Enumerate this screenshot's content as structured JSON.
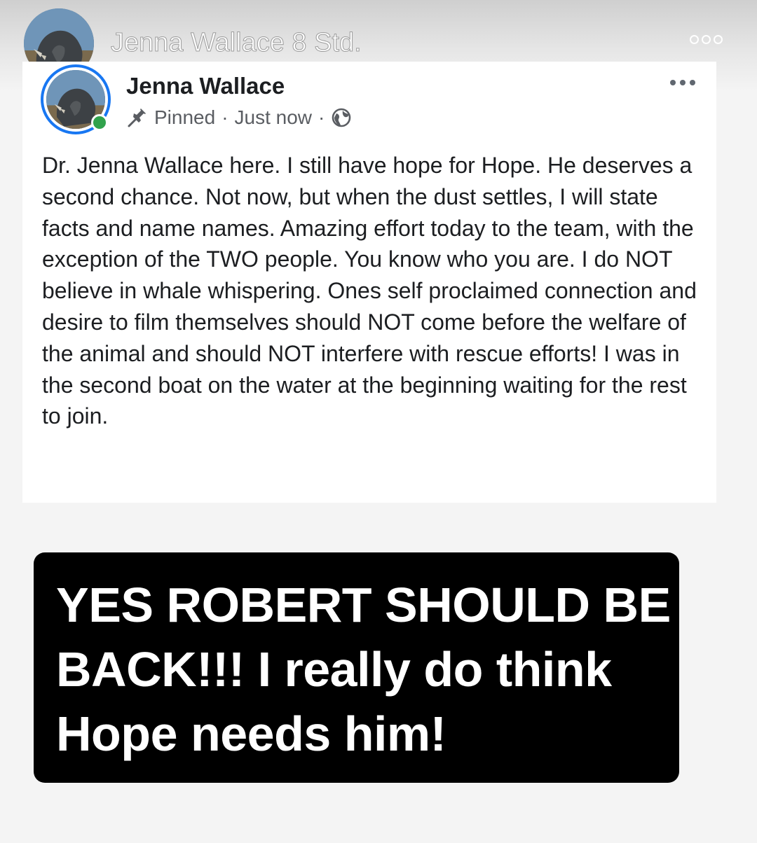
{
  "story": {
    "header_title": "Jenna Wallace 8 Std.",
    "avatar_icon": "profile-avatar-rhino",
    "menu_icon": "more-dots-outline-icon"
  },
  "post": {
    "author_name": "Jenna Wallace",
    "online": true,
    "pin_icon": "pin-icon",
    "pinned_label": "Pinned",
    "separator": "·",
    "timestamp": "Just now",
    "audience_icon": "globe-icon",
    "menu_icon": "more-dots-icon",
    "body": "Dr. Jenna Wallace here. I still have hope for Hope. He deserves a second chance. Not now, but when the dust settles, I will state facts and name names. Amazing effort today to the team, with the exception of the TWO people. You know who you are. I do NOT believe in whale whispering. Ones self proclaimed connection and desire to film themselves should NOT come before the welfare of the animal and should NOT interfere with rescue efforts! I was in the second boat on the water at the beginning waiting for the rest to join."
  },
  "caption": {
    "text": "YES ROBERT SHOULD BE BACK!!! I really do think Hope needs him!"
  },
  "colors": {
    "online_green": "#31a24c",
    "avatar_ring_blue": "#1877f2",
    "caption_background": "#000000",
    "caption_text": "#ffffff"
  }
}
